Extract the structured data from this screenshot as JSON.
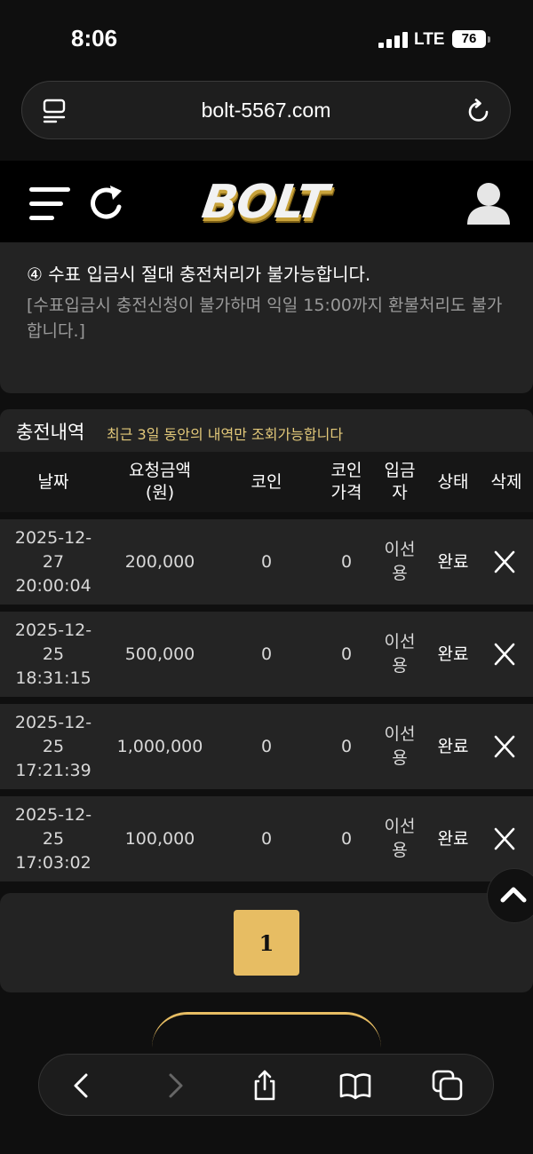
{
  "status_bar": {
    "time": "8:06",
    "network": "LTE",
    "battery": "76"
  },
  "browser": {
    "url": "bolt-5567.com"
  },
  "site": {
    "logo_text": "BOLT"
  },
  "notice": {
    "title": "④ 수표 입금시 절대 충전처리가 불가능합니다.",
    "desc": "[수표입금시 충전신청이 불가하며 익일 15:00까지 환불처리도 불가합니다.]"
  },
  "history": {
    "title": "충전내역",
    "subtitle": "최근 3일 동안의 내역만 조회가능합니다",
    "columns": {
      "date": "날짜",
      "amount": "요청금액\n(원)",
      "coin": "코인",
      "coin_price": "코인\n가격",
      "depositor": "입금\n자",
      "status": "상태",
      "delete": "삭제"
    },
    "rows": [
      {
        "date": "2025-12-\n27\n20:00:04",
        "amount": "200,000",
        "coin": "0",
        "coin_price": "0",
        "depositor": "이선\n용",
        "status": "완료"
      },
      {
        "date": "2025-12-\n25\n18:31:15",
        "amount": "500,000",
        "coin": "0",
        "coin_price": "0",
        "depositor": "이선\n용",
        "status": "완료"
      },
      {
        "date": "2025-12-\n25\n17:21:39",
        "amount": "1,000,000",
        "coin": "0",
        "coin_price": "0",
        "depositor": "이선\n용",
        "status": "완료"
      },
      {
        "date": "2025-12-\n25\n17:03:02",
        "amount": "100,000",
        "coin": "0",
        "coin_price": "0",
        "depositor": "이선\n용",
        "status": "완료"
      }
    ]
  },
  "pagination": {
    "current": "1"
  },
  "icons": {
    "menu": "hamburger-icon",
    "refresh": "refresh-icon",
    "user": "user-icon",
    "delete": "close-icon",
    "scroll_top": "chevron-up-icon"
  },
  "colors": {
    "accent": "#e7bd63",
    "subtitle": "#e3c97a",
    "background": "#0f0f0f",
    "panel": "#232323"
  }
}
